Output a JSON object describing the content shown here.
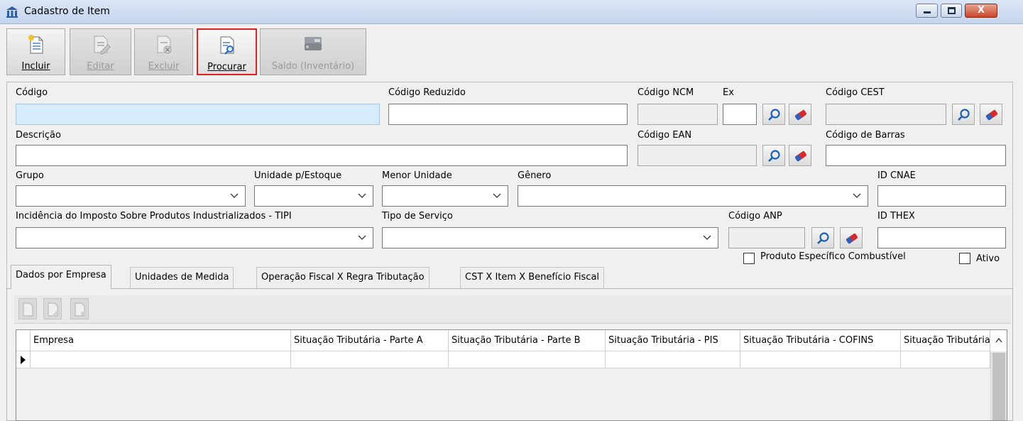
{
  "window": {
    "title": "Cadastro de Item",
    "close_glyph": "X"
  },
  "toolbar": {
    "incluir": "Incluir",
    "editar": "Editar",
    "excluir": "Excluir",
    "procurar": "Procurar",
    "saldo": "Saldo (Inventário)"
  },
  "form": {
    "codigo": "Código",
    "codigo_reduzido": "Código Reduzido",
    "codigo_ncm": "Código NCM",
    "ex": "Ex",
    "codigo_cest": "Código CEST",
    "descricao": "Descrição",
    "codigo_ean": "Código EAN",
    "codigo_barras": "Código de Barras",
    "grupo": "Grupo",
    "unidade_estoque": "Unidade p/Estoque",
    "menor_unidade": "Menor Unidade",
    "genero": "Gênero",
    "id_cnae": "ID CNAE",
    "incidencia_ipi": "Incidência do Imposto Sobre Produtos Industrializados - TIPI",
    "tipo_servico": "Tipo de Serviço",
    "codigo_anp": "Código ANP",
    "id_thex": "ID THEX",
    "produto_combustivel": "Produto Específico Combustível",
    "ativo": "Ativo"
  },
  "tabs": [
    "Dados por Empresa",
    "Unidades de Medida",
    "Operação Fiscal X Regra Tributação",
    "CST X Item X Benefício Fiscal"
  ],
  "grid": {
    "columns": [
      "Empresa",
      "Situação Tributária - Parte A",
      "Situação Tributária - Parte B",
      "Situação Tributária - PIS",
      "Situação Tributária - COFINS",
      "Situação Tributária"
    ]
  },
  "colors": {
    "highlight_border": "#e0201d",
    "focused_input": "#d7ecfb",
    "titlebar": "#c4d5ee"
  }
}
